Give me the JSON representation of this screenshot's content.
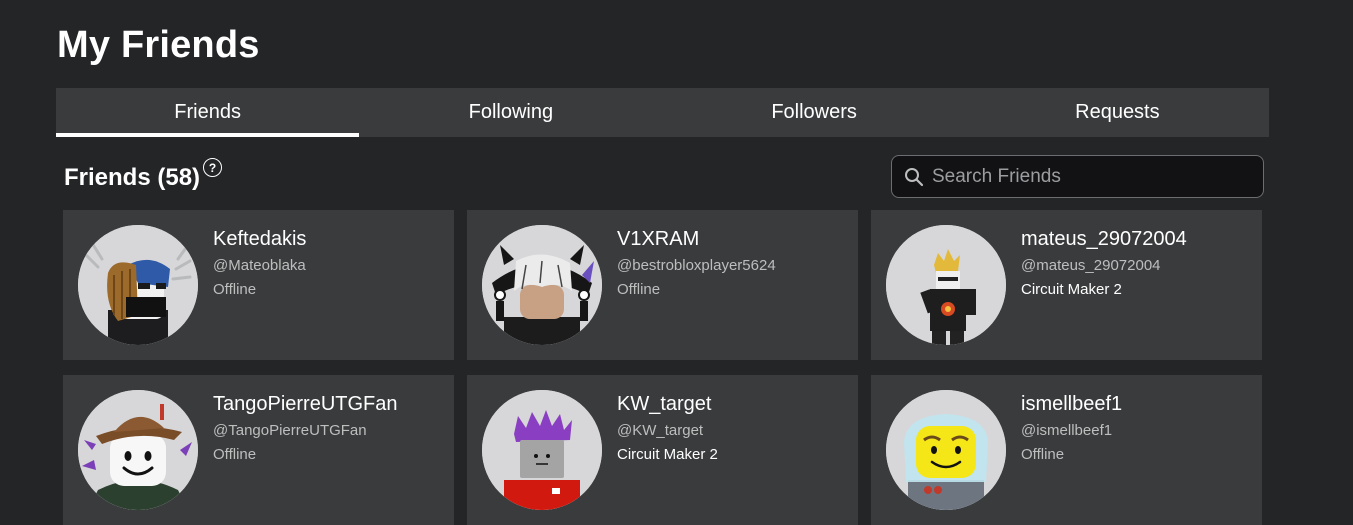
{
  "page": {
    "title": "My Friends"
  },
  "tabs": [
    {
      "label": "Friends",
      "active": true
    },
    {
      "label": "Following",
      "active": false
    },
    {
      "label": "Followers",
      "active": false
    },
    {
      "label": "Requests",
      "active": false
    }
  ],
  "section": {
    "title": "Friends (58)",
    "help_icon": "question-circle-icon"
  },
  "search": {
    "placeholder": "Search Friends",
    "value": "",
    "icon": "search-icon"
  },
  "friends": [
    {
      "display_name": "Keftedakis",
      "username": "@Mateoblaka",
      "status": "Offline"
    },
    {
      "display_name": "V1XRAM",
      "username": "@bestrobloxplayer5624",
      "status": "Offline"
    },
    {
      "display_name": "mateus_29072004",
      "username": "@mateus_29072004",
      "status": "Circuit Maker 2"
    },
    {
      "display_name": "TangoPierreUTGFan",
      "username": "@TangoPierreUTGFan",
      "status": "Offline"
    },
    {
      "display_name": "KW_target",
      "username": "@KW_target",
      "status": "Circuit Maker 2"
    },
    {
      "display_name": "ismellbeef1",
      "username": "@ismellbeef1",
      "status": "Offline"
    }
  ],
  "colors": {
    "background": "#232527",
    "tab_bar": "#393b3d",
    "card": "#393b3d",
    "search_bg": "#121215",
    "muted_text": "#bdbebe",
    "avatar_bg": "#d4d4d6"
  }
}
